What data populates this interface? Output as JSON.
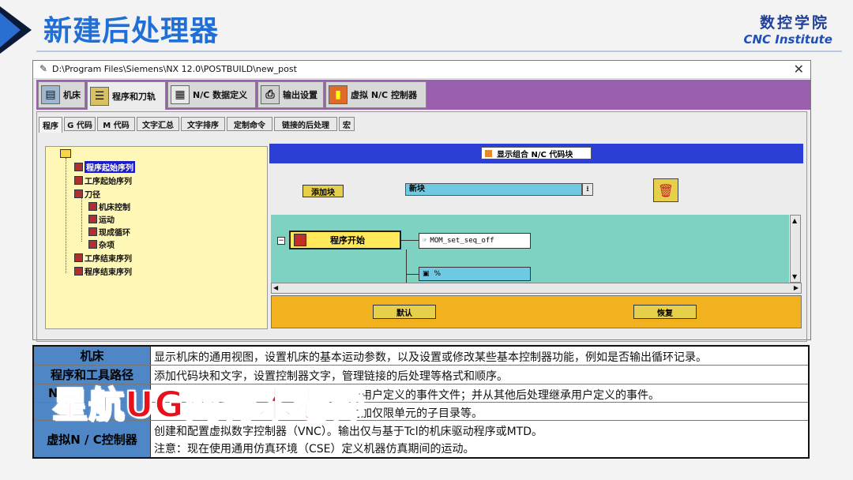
{
  "slide": {
    "title": "新建后处理器",
    "logo_cn": "数控学院",
    "logo_en": "CNC Institute"
  },
  "window": {
    "path": "D:\\Program Files\\Siemens\\NX 12.0\\POSTBUILD\\new_post",
    "main_tabs": [
      {
        "label": "机床",
        "icon": "machine-icon"
      },
      {
        "label": "程序和刀轨",
        "icon": "program-icon"
      },
      {
        "label": "N/C 数据定义",
        "icon": "nc-data-icon"
      },
      {
        "label": "输出设置",
        "icon": "printer-icon"
      },
      {
        "label": "虚拟 N/C 控制器",
        "icon": "controller-icon"
      }
    ],
    "sub_tabs": [
      "程序",
      "G 代码",
      "M 代码",
      "文字汇总",
      "文字排序",
      "定制命令",
      "链接的后处理",
      "宏"
    ],
    "tree": {
      "nodes": [
        "程序起始序列",
        "工序起始序列",
        "刀径",
        "机床控制",
        "运动",
        "现成循环",
        "杂项",
        "工序结束序列",
        "程序结束序列"
      ]
    },
    "show_combined": "显示组合 N/C 代码块",
    "add_block": "添加块",
    "new_block_value": "新块",
    "start_block": "程序开始",
    "event_block": "MOM_set_seq_off",
    "percent_block": "%",
    "default_button": "默认",
    "restore_button": "恢复",
    "colors": {
      "purple": "#9b5fb0",
      "blue": "#2b3ed6",
      "teal": "#7ed2c1",
      "orange": "#f2b21f"
    }
  },
  "desc_table": {
    "rows": [
      {
        "head": "机床",
        "text": [
          "显示机床的通用视图，设置机床的基本运动参数，以及设置或修改某些基本控制器功能，例如是否输出循环记录。"
        ]
      },
      {
        "head": "程序和工具路径",
        "text": [
          "添加代码块和文字，设置控制器文字，管理链接的后处理等格式和顺序。"
        ]
      },
      {
        "head": "N",
        "text": [
          "和用户定义的事件文件；并从其他后处理继承用户定义的事件。"
        ]
      },
      {
        "head": "",
        "text": [
          "附加仅限单元的子目录等。"
        ]
      },
      {
        "head": "虚拟N / C控制器",
        "text": [
          "创建和配置虚拟数字控制器（VNC）。输出仅与基于Tcl的机床驱动程序或MTD。",
          "注意：现在使用通用仿真环境（CSE）定义机器仿真期间的运动。"
        ]
      }
    ]
  },
  "watermark": "星航UG网青木老师"
}
